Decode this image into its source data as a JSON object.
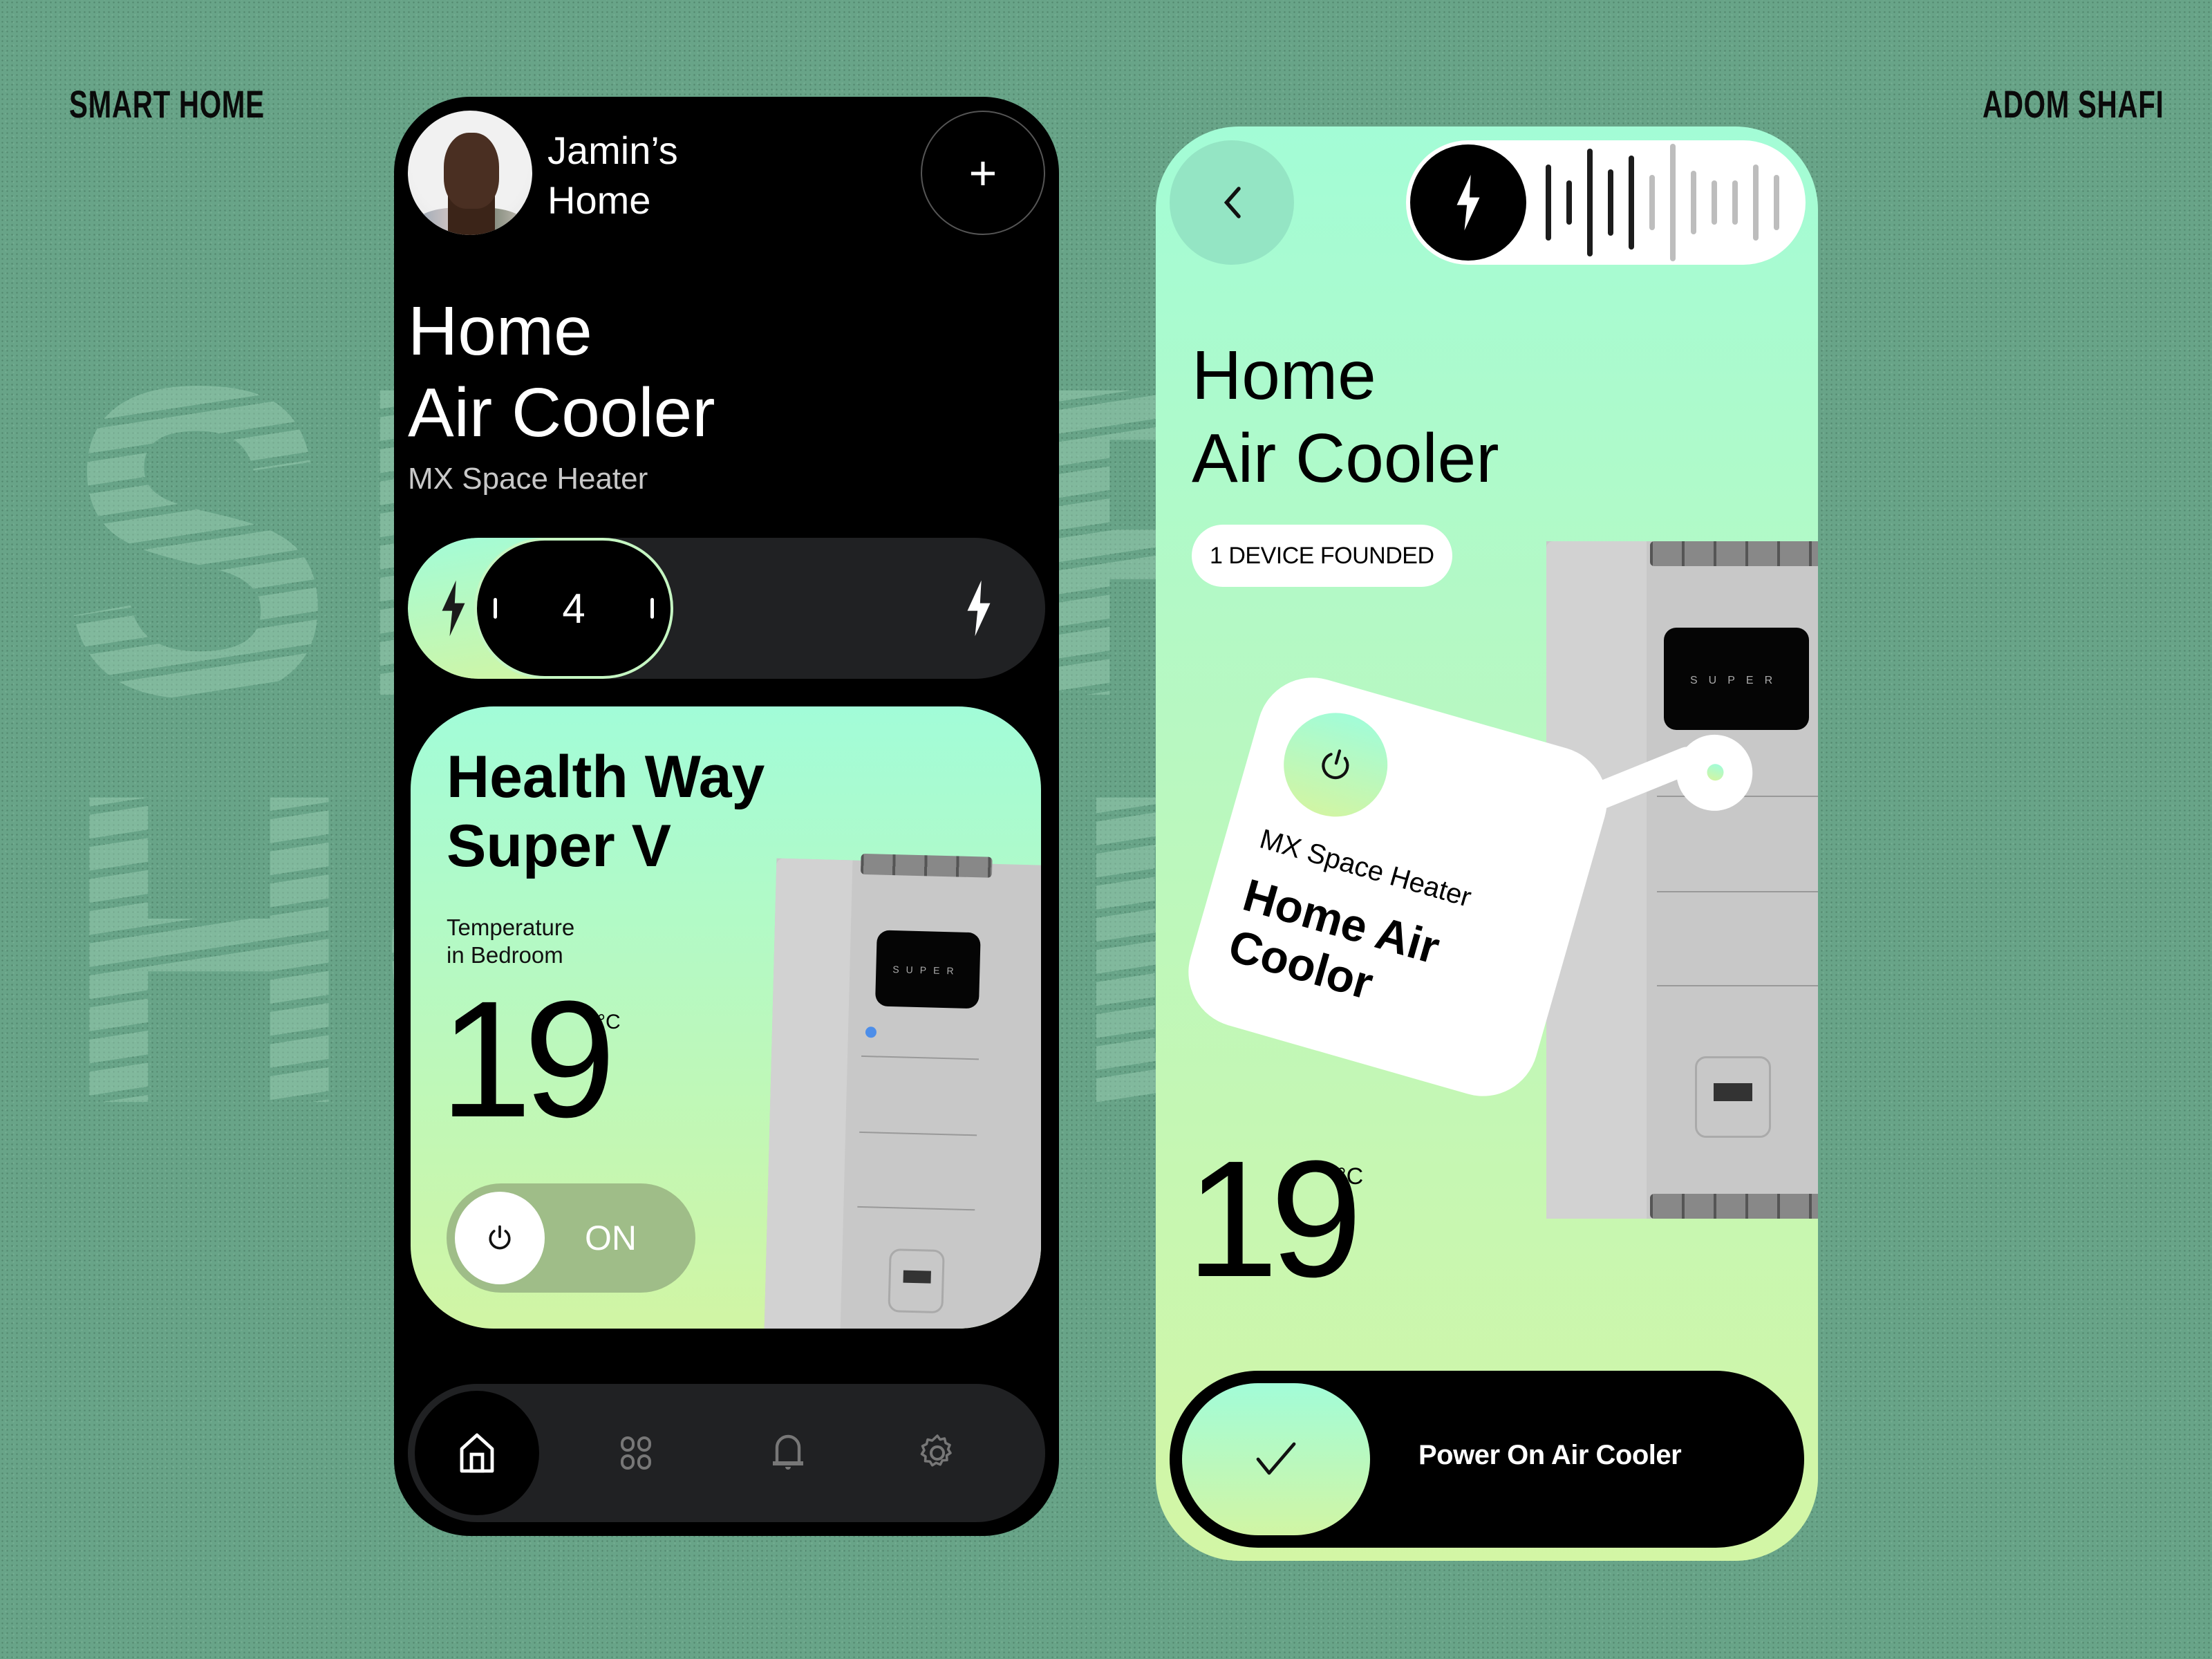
{
  "page": {
    "corner_left": "SMART HOME",
    "corner_right": "ADOM SHAFI",
    "watermark": "SMART\nHOME",
    "background_color": "#68a488",
    "accent_gradient": [
      "#a2fcd8",
      "#d1f5a4"
    ]
  },
  "left_phone": {
    "header": {
      "home_name": "Jamin’s Home",
      "home_name_line1": "Jamin’s",
      "home_name_line2": "Home",
      "add_button_icon": "plus-icon",
      "add_button_label": "+"
    },
    "title_line1": "Home",
    "title_line2": "Air Cooler",
    "subtitle": "MX Space Heater",
    "level_slider": {
      "value": 4,
      "value_label": "4",
      "min_icon": "bolt-icon",
      "max_icon": "bolt-icon"
    },
    "device_card": {
      "name_line1": "Health Way",
      "name_line2": "Super V",
      "temp_label_line1": "Temperature",
      "temp_label_line2": "in Bedroom",
      "temperature": "19",
      "unit": "°C",
      "power_toggle": {
        "state": "ON",
        "icon": "power-icon"
      },
      "product_screen_text": "SUPER"
    },
    "bottom_nav": [
      {
        "id": "home",
        "icon": "home-icon",
        "active": true
      },
      {
        "id": "devices",
        "icon": "grid-icon",
        "active": false
      },
      {
        "id": "notifications",
        "icon": "bell-icon",
        "active": false
      },
      {
        "id": "settings",
        "icon": "gear-icon",
        "active": false
      }
    ]
  },
  "right_phone": {
    "back_icon": "chevron-left-icon",
    "voice_control": {
      "icon": "bolt-icon",
      "bars_active": 5,
      "bars_total": 12,
      "bar_levels": [
        0.55,
        0.32,
        0.78,
        0.48,
        0.68,
        0.4,
        0.85,
        0.46,
        0.32,
        0.32,
        0.55,
        0.4
      ]
    },
    "title_line1": "Home",
    "title_line2": "Air Cooler",
    "badge": "1 DEVICE FOUNDED",
    "tag": {
      "icon": "power-icon",
      "subtitle": "MX Space Heater",
      "title": "Home Air Coolor"
    },
    "temperature": "19",
    "unit": "°C",
    "power_slide": {
      "icon": "check-icon",
      "label": "Power  On Air Cooler"
    },
    "product_screen_text": "SUPER"
  }
}
